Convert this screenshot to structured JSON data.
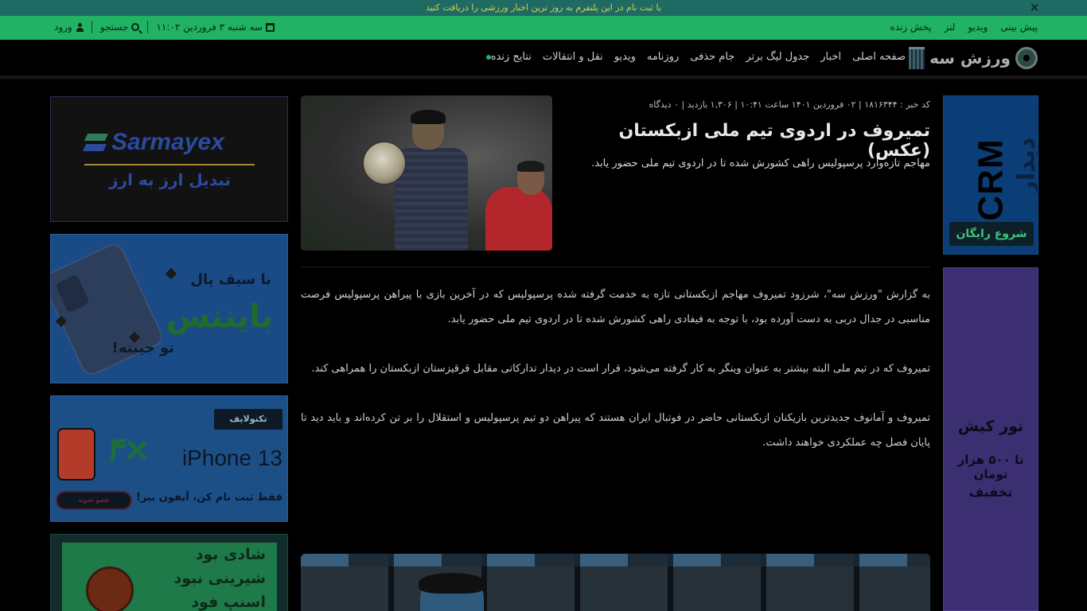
{
  "notice": {
    "text": "با ثبت نام در این پلتفرم به روز ترین اخبار ورزشی را دریافت کنید",
    "close_icon": "close-icon"
  },
  "utility": {
    "links": [
      "پیش بینی",
      "ویدیو",
      "لنز",
      "پخش زنده"
    ],
    "date": "سه شنبه ۳ فروردین ۱۱:۰۲",
    "search_label": "جستجو",
    "login_label": "ورود"
  },
  "nav": {
    "logo_text": "ورزش سه",
    "items": [
      "صفحه اصلی",
      "اخبار",
      "جدول لیگ برتر",
      "جام حذفی",
      "روزنامه",
      "ویدیو",
      "نقل و انتقالات",
      "نتایج زنده"
    ]
  },
  "article": {
    "meta": "کد خبر : ۱۸۱۶۳۴۴ | ۰۲ فروردین ۱۴۰۱ ساعت ۱۰:۴۱ | ۱,۳۰۶ بازدید | ۰ دیدگاه",
    "title": "تمیروف در اردوی تیم ملی ازبکستان (عکس)",
    "lead": "مهاجم تازه‌وارد پرسپولیس راهی کشورش شده تا در اردوی تیم ملی حضور یابد.",
    "paragraphs": [
      "به گزارش \"ورزش سه\"، شرزود تمیروف مهاجم ازبکستانی تازه به خدمت گرفته شده پرسپولیس که در آخرین بازی با پیراهن پرسپولیس فرصت مناسبی در جدال دربی به دست آورده بود، با توجه به فیفادی راهی کشورش شده تا در اردوی تیم ملی حضور یابد.",
      "تمیروف که در تیم ملی البته بیشتر به عنوان وینگر به کار گرفته می‌شود، قرار است در دیدار تدارکاتی مقابل قرقیزستان ازبکستان را همراهی کند.",
      "تمیروف و آمانوف جدیدترین بازیکنان ازبکستانی حاضر در فوتبال ایران هستند که پیراهن دو تیم پرسپولیس و استقلال را بر تن کرده‌اند و باید دید تا پایان فصل چه عملکردی خواهند داشت."
    ]
  },
  "ads": {
    "crm": {
      "word": "CRM",
      "fa": "دیدار",
      "button": "شروع رایگان"
    },
    "kish": {
      "line1": "تور کیش",
      "line2": "تا ۵۰۰ هزار تومان",
      "line3": "تخفیف"
    },
    "sarmayex": {
      "name": "Sarmayex",
      "tagline": "تبدیل ارز به ارز"
    },
    "safepal": {
      "line1": "با سیف پال",
      "line2": "بایننس",
      "line3": "تو جیبته!"
    },
    "iphone": {
      "brand": "تکنولایف",
      "multiplier": "۴×",
      "model": "iPhone 13",
      "cta": "فقط ثبت نام کن، آیفون ببر!",
      "button": "عضو شوید"
    },
    "shadi": {
      "line1": "شادی بود",
      "line2": "شیرینی نبود",
      "line3": "اسنپ فود"
    }
  },
  "colors": {
    "notice_bg": "#1f6b63",
    "utility_bg": "#21b264",
    "nav_bg": "#000000",
    "accent_green": "#21b264"
  }
}
